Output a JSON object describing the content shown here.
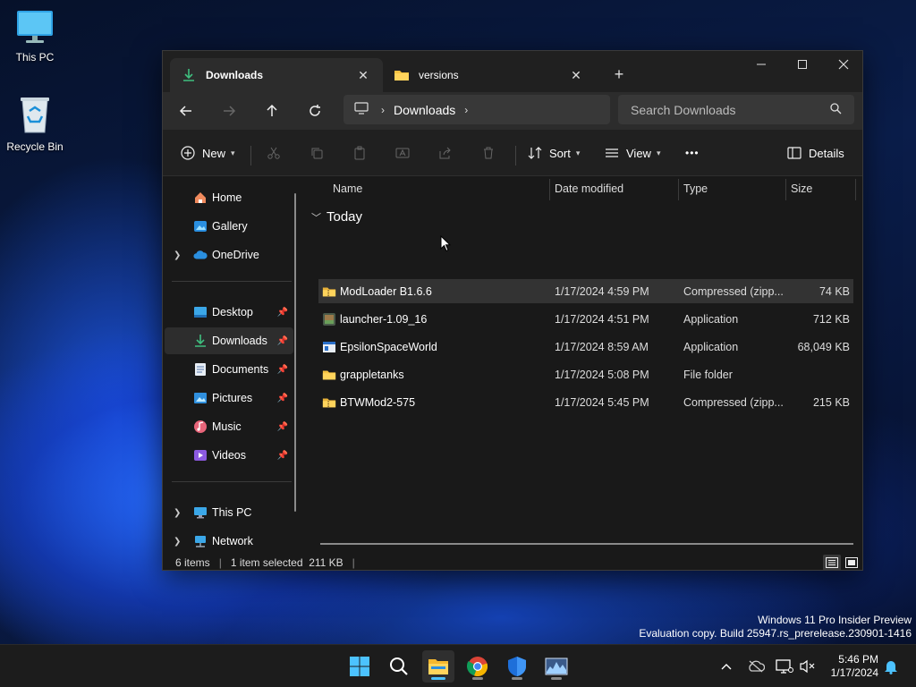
{
  "desktop": {
    "icons": [
      {
        "label": "This PC"
      },
      {
        "label": "Recycle Bin"
      }
    ]
  },
  "window": {
    "tabs": [
      {
        "label": "Downloads",
        "active": true
      },
      {
        "label": "versions",
        "active": false
      }
    ],
    "address": {
      "crumbs": [
        "Downloads"
      ]
    },
    "search": {
      "placeholder": "Search Downloads"
    },
    "toolbar": {
      "new_label": "New",
      "sort_label": "Sort",
      "view_label": "View",
      "more_label": "•••",
      "details_label": "Details"
    },
    "nav": {
      "home": "Home",
      "gallery": "Gallery",
      "onedrive": "OneDrive",
      "desktop": "Desktop",
      "downloads": "Downloads",
      "documents": "Documents",
      "pictures": "Pictures",
      "music": "Music",
      "videos": "Videos",
      "thispc": "This PC",
      "network": "Network"
    },
    "columns": {
      "name": "Name",
      "date": "Date modified",
      "type": "Type",
      "size": "Size"
    },
    "group": "Today",
    "files": [
      {
        "name": "ModLoader B1.6.6",
        "date": "1/17/2024 4:59 PM",
        "type": "Compressed (zipp...",
        "size": "74 KB",
        "icon": "zip-folder-icon",
        "selected": true
      },
      {
        "name": "launcher-1.09_16",
        "date": "1/17/2024 4:51 PM",
        "type": "Application",
        "size": "712 KB",
        "icon": "app-icon",
        "selected": false
      },
      {
        "name": "EpsilonSpaceWorld",
        "date": "1/17/2024 8:59 AM",
        "type": "Application",
        "size": "68,049 KB",
        "icon": "app-window-icon",
        "selected": false
      },
      {
        "name": "grappletanks",
        "date": "1/17/2024 5:08 PM",
        "type": "File folder",
        "size": "",
        "icon": "folder-icon",
        "selected": false
      },
      {
        "name": "BTWMod2-575",
        "date": "1/17/2024 5:45 PM",
        "type": "Compressed (zipp...",
        "size": "215 KB",
        "icon": "zip-folder-icon",
        "selected": false
      }
    ],
    "status": {
      "count": "6 items",
      "selection": "1 item selected  211 KB"
    }
  },
  "watermark": {
    "line1": "Windows 11 Pro Insider Preview",
    "line2": "Evaluation copy. Build 25947.rs_prerelease.230901-1416"
  },
  "taskbar": {
    "time": "5:46 PM",
    "date": "1/17/2024"
  }
}
